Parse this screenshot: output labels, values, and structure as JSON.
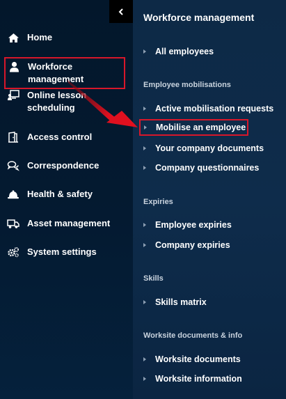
{
  "sidebar": {
    "items": [
      {
        "label": "Home",
        "icon": "home-icon"
      },
      {
        "label": "Workforce management",
        "icon": "user-icon",
        "active": true
      },
      {
        "label": "Online lesson scheduling",
        "icon": "lesson-icon"
      },
      {
        "label": "Access control",
        "icon": "door-icon"
      },
      {
        "label": "Correspondence",
        "icon": "chat-icon"
      },
      {
        "label": "Health & safety",
        "icon": "hardhat-icon"
      },
      {
        "label": "Asset management",
        "icon": "truck-icon"
      },
      {
        "label": "System settings",
        "icon": "gears-icon"
      }
    ]
  },
  "panel": {
    "title": "Workforce management",
    "top_links": [
      "All employees"
    ],
    "sections": [
      {
        "title": "Employee mobilisations",
        "links": [
          "Active mobilisation requests",
          "Mobilise an employee",
          "Your company documents",
          "Company questionnaires"
        ]
      },
      {
        "title": "Expiries",
        "links": [
          "Employee expiries",
          "Company expiries"
        ]
      },
      {
        "title": "Skills",
        "links": [
          "Skills matrix"
        ]
      },
      {
        "title": "Worksite documents & info",
        "links": [
          "Worksite documents",
          "Worksite information"
        ]
      }
    ]
  },
  "colors": {
    "highlight": "#d8172a",
    "sidebar_bg": "#03172b",
    "panel_bg": "#0d2946"
  }
}
